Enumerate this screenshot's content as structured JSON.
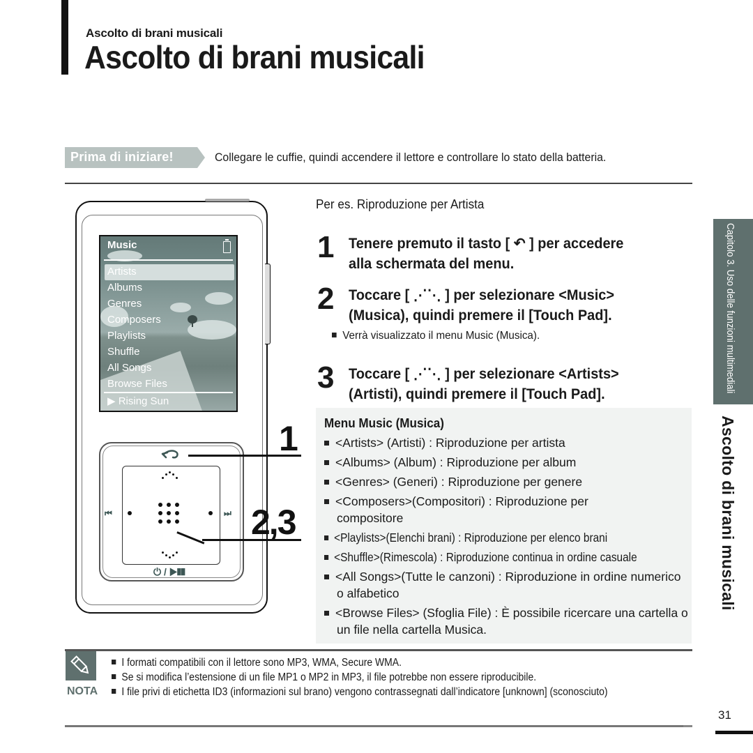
{
  "header": {
    "running_title": "Ascolto di brani musicali",
    "title": "Ascolto di brani musicali"
  },
  "before_start": {
    "label": "Prima di iniziare!",
    "text": "Collegare le cuffie, quindi accendere il lettore e controllare lo stato della batteria."
  },
  "device": {
    "screen_title": "Music",
    "battery_icon": "battery-icon",
    "menu_items": [
      {
        "label": "Artists",
        "selected": true
      },
      {
        "label": "Albums",
        "selected": false
      },
      {
        "label": "Genres",
        "selected": false
      },
      {
        "label": "Composers",
        "selected": false
      },
      {
        "label": "Playlists",
        "selected": false
      },
      {
        "label": "Shuffle",
        "selected": false
      },
      {
        "label": "All Songs",
        "selected": false
      },
      {
        "label": "Browse Files",
        "selected": false
      }
    ],
    "now_playing": "▶ Rising Sun",
    "pad": {
      "back_glyph": "↶",
      "prev_glyph": "⏮",
      "next_glyph": "⏭",
      "power_play_glyph": "⏻ / ▶❚❚"
    },
    "callouts": [
      "1",
      "2,3"
    ]
  },
  "instructions": {
    "example": "Per es. Riproduzione per Artista",
    "steps": [
      {
        "number": "1",
        "lines": [
          "Tenere premuto il tasto [ ↶ ] per accedere",
          "alla schermata del menu."
        ]
      },
      {
        "number": "2",
        "lines": [
          "Toccare [ ⋰⋱ ] per selezionare <Music>",
          "(Musica), quindi premere il [Touch Pad]."
        ],
        "note": "Verrà visualizzato il menu Music (Musica)."
      },
      {
        "number": "3",
        "lines": [
          "Toccare [ ⋰⋱ ] per selezionare <Artists>",
          "(Artisti), quindi premere il [Touch Pad]."
        ]
      }
    ]
  },
  "music_menu": {
    "title": "Menu Music (Musica)",
    "items": [
      "<Artists> (Artisti) : Riproduzione per artista",
      "<Albums> (Album) : Riproduzione per album",
      "<Genres> (Generi) : Riproduzione per genere",
      "<Composers>(Compositori) : Riproduzione per compositore",
      "<Playlists>(Elenchi brani) : Riproduzione per elenco brani",
      "<Shuffle>(Rimescola) : Riproduzione continua in ordine casuale",
      "<All Songs>(Tutte le canzoni) : Riproduzione in ordine numerico o alfabetico",
      "<Browse Files> (Sfoglia File) : È possibile ricercare una cartella o un file nella cartella Musica."
    ]
  },
  "sidebar": {
    "chapter": "Capitolo 3. Uso delle funzioni multimediali",
    "section": "Ascolto di brani musicali"
  },
  "nota": {
    "label": "NOTA",
    "items": [
      "I formati compatibili con il lettore sono MP3, WMA, Secure WMA.",
      "Se si modifica l’estensione di un file MP1 o MP2 in MP3, il file potrebbe non essere riproducibile.",
      "I file privi di etichetta ID3 (informazioni sul brano) vengono contrassegnati dall’indicatore [unknown] (sconosciuto)"
    ]
  },
  "page_number": "31",
  "colors": {
    "accent_gray": "#5f706e",
    "tag_gray": "#b8c2c0",
    "menu_box_bg": "#f1f3f2"
  }
}
